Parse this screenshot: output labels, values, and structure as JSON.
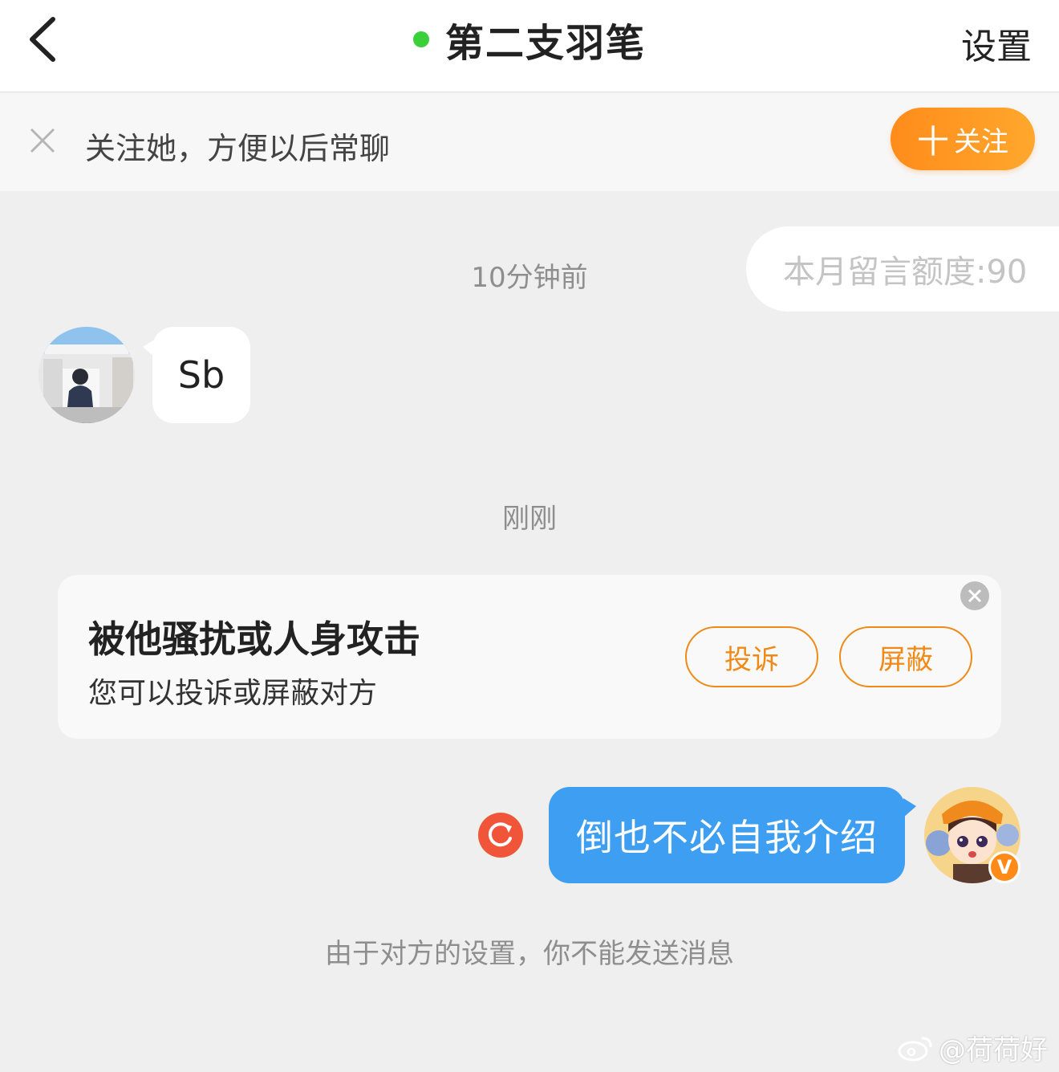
{
  "header": {
    "title": "第二支羽笔",
    "settings_label": "设置",
    "online_color": "#3ccf3c"
  },
  "follow_bar": {
    "text": "关注她，方便以后常聊",
    "follow_button_plus": "十",
    "follow_button_label": "关注"
  },
  "quota": {
    "text": "本月留言额度:90"
  },
  "messages": {
    "timestamp_1": "10分钟前",
    "incoming_text": "Sb",
    "timestamp_2": "刚刚",
    "outgoing_text": "倒也不必自我介绍",
    "verified_badge": "V"
  },
  "harassment_card": {
    "title": "被他骚扰或人身攻击",
    "subtitle": "您可以投诉或屏蔽对方",
    "report_label": "投诉",
    "block_label": "屏蔽"
  },
  "notice": "由于对方的设置，你不能发送消息",
  "watermark": "@荷荷好",
  "colors": {
    "accent_orange": "#f08a17",
    "bubble_blue": "#3e9ff2",
    "retry_red": "#f0553a"
  },
  "icons": [
    "back-chevron-icon",
    "close-icon",
    "retry-icon",
    "card-close-icon",
    "verified-icon",
    "weibo-logo-icon"
  ]
}
